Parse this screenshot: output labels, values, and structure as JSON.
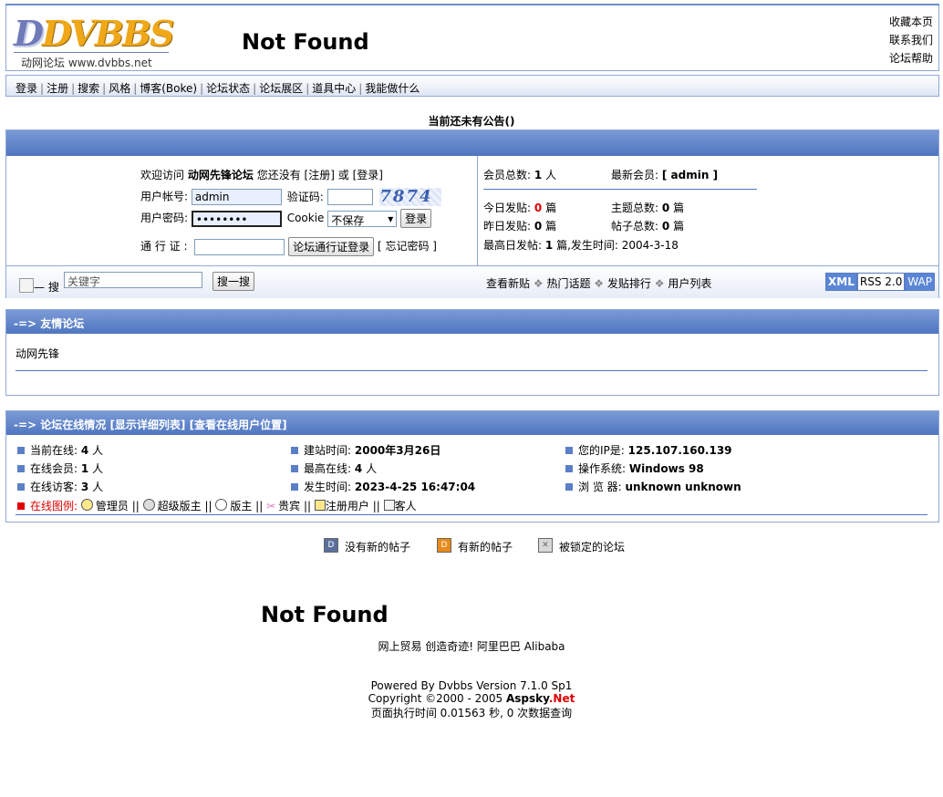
{
  "header": {
    "logo_text": "DVBBS",
    "logo_sub": "动网论坛 www.dvbbs.net",
    "not_found": "Not Found",
    "links": [
      "收藏本页",
      "联系我们",
      "论坛帮助"
    ]
  },
  "nav": {
    "items": [
      "登录",
      "注册",
      "搜索",
      "风格",
      "博客(Boke)",
      "论坛状态",
      "论坛展区",
      "道具中心",
      "我能做什么"
    ]
  },
  "announcement": "当前还未有公告()",
  "login": {
    "welcome_pre": "欢迎访问",
    "forum_name": "动网先锋论坛",
    "welcome_mid": "您还没有",
    "register_link": "[注册]",
    "or": "或",
    "login_link": "[登录]",
    "username_label": "用户帐号:",
    "username_value": "admin",
    "captcha_label": "验证码:",
    "captcha_text": "7874",
    "password_label": "用户密码:",
    "password_value": "••••••••",
    "cookie_label": "Cookie",
    "cookie_option": "不保存",
    "login_button": "登录",
    "passport_label": "通 行 证 :",
    "passport_button": "论坛通行证登录",
    "forgot_link": "[ 忘记密码 ]"
  },
  "stats": {
    "members_label": "会员总数:",
    "members_value": "1",
    "members_unit": "人",
    "newest_label": "最新会员:",
    "newest_value": "[ admin ]",
    "today_label": "今日发贴:",
    "today_value": "0",
    "today_unit": "篇",
    "topics_label": "主题总数:",
    "topics_value": "0",
    "topics_unit": "篇",
    "yesterday_label": "昨日发贴:",
    "yesterday_value": "0",
    "yesterday_unit": "篇",
    "posts_label": "帖子总数:",
    "posts_value": "0",
    "posts_unit": "篇",
    "peak_label": "最高日发帖:",
    "peak_value": "1",
    "peak_unit": "篇,发生时间:",
    "peak_date": "2004-3-18"
  },
  "search": {
    "image_alt": "搜",
    "placeholder": "关键字",
    "button": "搜一搜",
    "links": [
      "查看新贴",
      "热门话题",
      "发贴排行",
      "用户列表"
    ],
    "badges": [
      "XML",
      "RSS 2.0",
      "WAP"
    ]
  },
  "friends": {
    "title": "-=> 友情论坛",
    "item": "动网先锋"
  },
  "online": {
    "title": "-=> 论坛在线情况 [显示详细列表] [查看在线用户位置]",
    "col1": [
      {
        "label": "当前在线:",
        "value": "4",
        "unit": "人"
      },
      {
        "label": "在线会员:",
        "value": "1",
        "unit": "人"
      },
      {
        "label": "在线访客:",
        "value": "3",
        "unit": "人"
      }
    ],
    "col2": [
      {
        "label": "建站时间:",
        "value": "2000年3月26日"
      },
      {
        "label": "最高在线:",
        "value": "4",
        "unit": "人"
      },
      {
        "label": "发生时间:",
        "value": "2023-4-25 16:47:04"
      }
    ],
    "col3": [
      {
        "label": "您的IP是:",
        "value": "125.107.160.139"
      },
      {
        "label": "操作系统:",
        "value": "Windows 98"
      },
      {
        "label": "浏 览 器:",
        "value": "unknown unknown"
      }
    ],
    "legend_label": "在线图例:",
    "legend": [
      "管理员",
      "超级版主",
      "版主",
      "贵宾",
      "注册用户",
      "客人"
    ]
  },
  "forum_legend": [
    "没有新的帖子",
    "有新的帖子",
    "被锁定的论坛"
  ],
  "footer": {
    "not_found": "Not Found",
    "ad": "网上贸易 创造奇迹! 阿里巴巴 Alibaba",
    "powered": "Powered By Dvbbs Version 7.1.0 Sp1",
    "copyright_pre": "Copyright ©2000 - 2005",
    "copyright_brand_a": "Aspsky",
    "copyright_brand_b": ".Net",
    "exec": "页面执行时间 0.01563 秒, 0 次数据查询"
  },
  "colors": {
    "accent": "#4f76c0",
    "border": "#8fa8d8",
    "red": "#e00000"
  }
}
